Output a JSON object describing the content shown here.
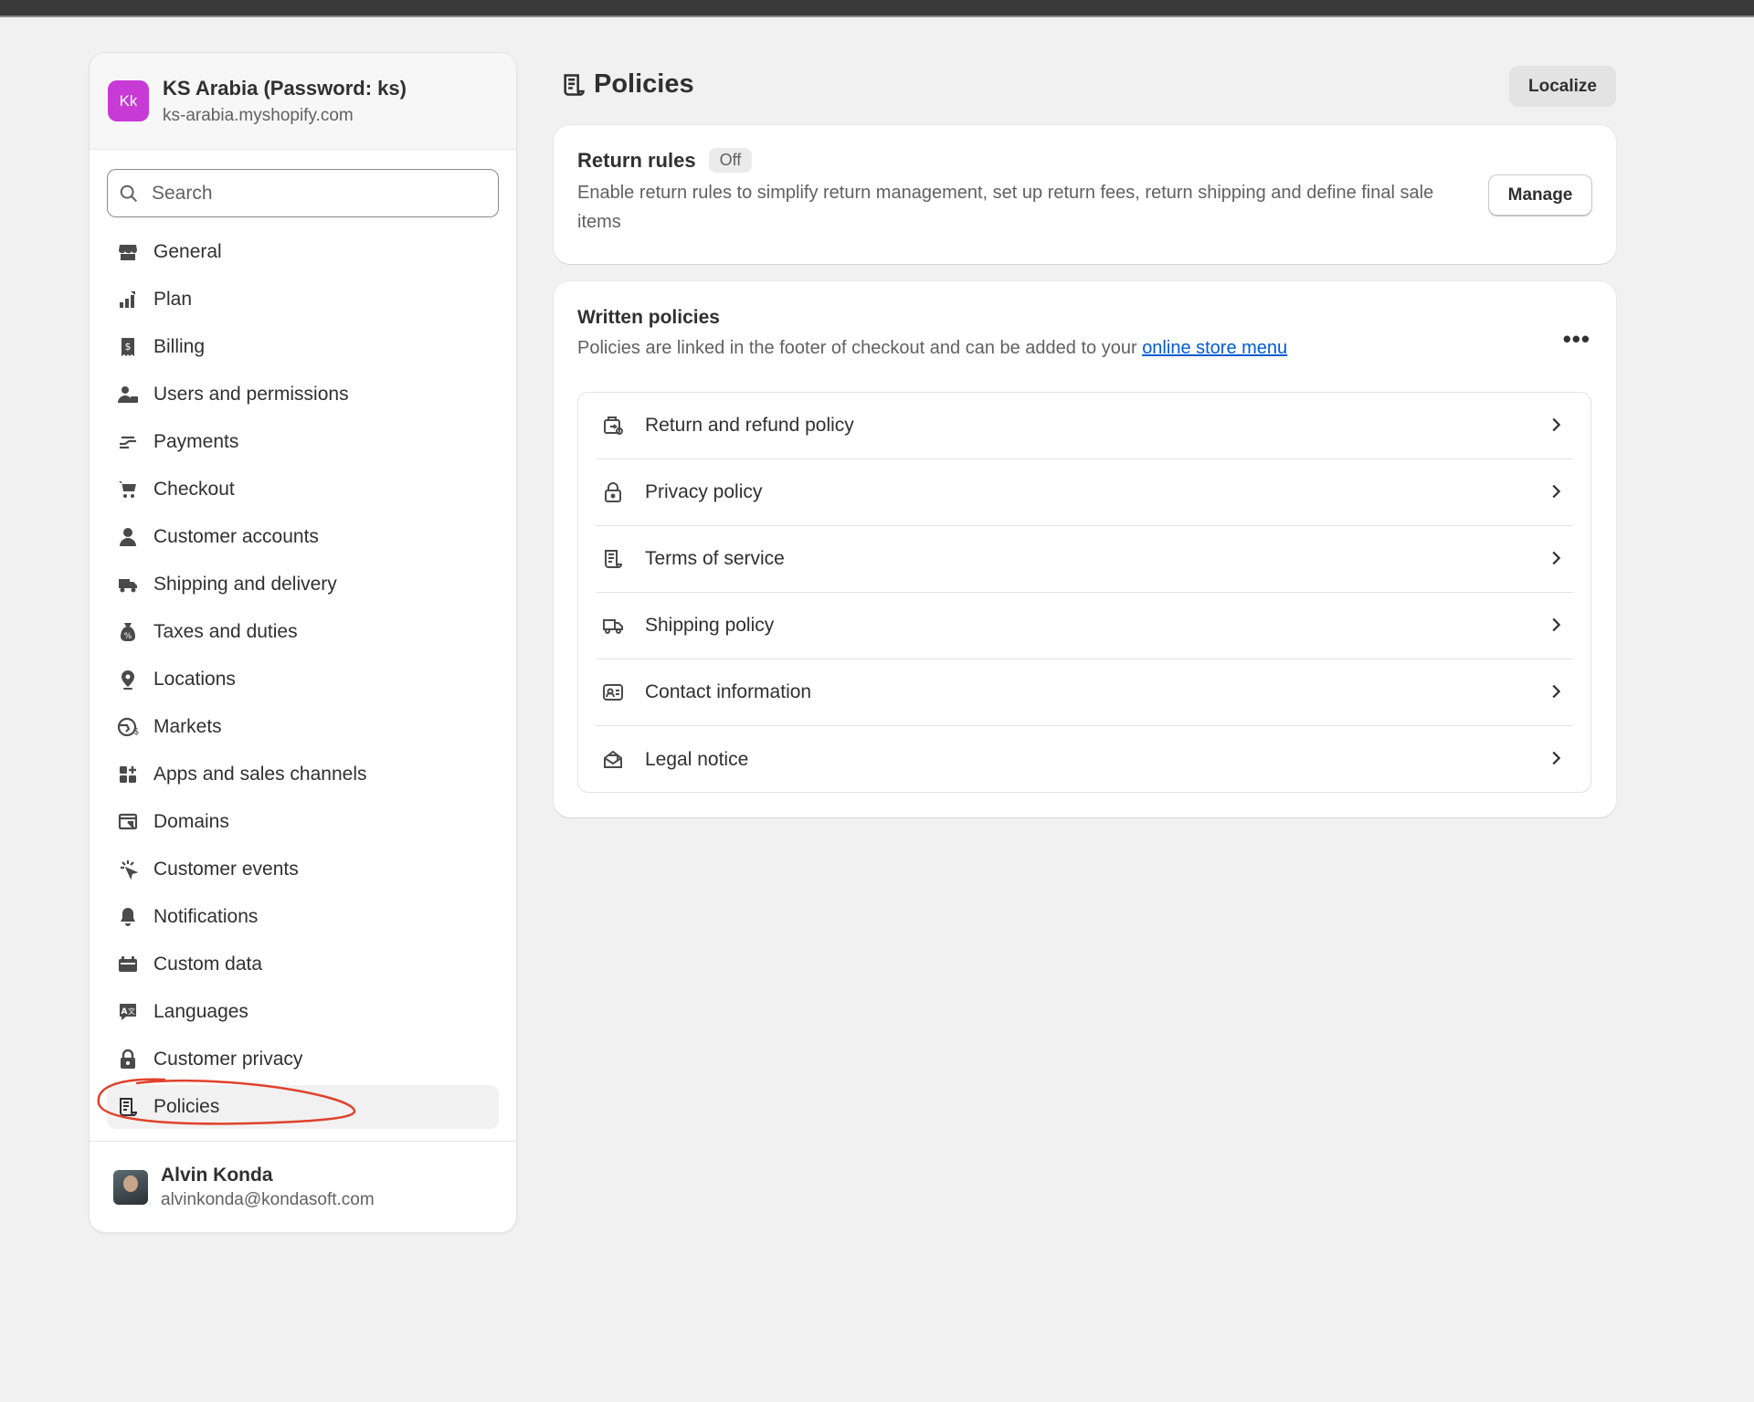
{
  "store": {
    "initials": "Kk",
    "name": "KS Arabia (Password: ks)",
    "domain": "ks-arabia.myshopify.com",
    "avatar_color": "#c73ad6"
  },
  "search": {
    "placeholder": "Search",
    "icon": "search-icon"
  },
  "nav": [
    {
      "label": "General",
      "icon": "store-icon"
    },
    {
      "label": "Plan",
      "icon": "plan-icon"
    },
    {
      "label": "Billing",
      "icon": "billing-icon"
    },
    {
      "label": "Users and permissions",
      "icon": "users-icon"
    },
    {
      "label": "Payments",
      "icon": "payments-icon"
    },
    {
      "label": "Checkout",
      "icon": "cart-icon"
    },
    {
      "label": "Customer accounts",
      "icon": "person-icon"
    },
    {
      "label": "Shipping and delivery",
      "icon": "truck-icon"
    },
    {
      "label": "Taxes and duties",
      "icon": "tax-bag-icon"
    },
    {
      "label": "Locations",
      "icon": "location-pin-icon"
    },
    {
      "label": "Markets",
      "icon": "globe-icon"
    },
    {
      "label": "Apps and sales channels",
      "icon": "apps-icon"
    },
    {
      "label": "Domains",
      "icon": "domains-icon"
    },
    {
      "label": "Customer events",
      "icon": "cursor-click-icon"
    },
    {
      "label": "Notifications",
      "icon": "bell-icon"
    },
    {
      "label": "Custom data",
      "icon": "custom-data-icon"
    },
    {
      "label": "Languages",
      "icon": "translate-icon"
    },
    {
      "label": "Customer privacy",
      "icon": "lock-icon"
    },
    {
      "label": "Policies",
      "icon": "policy-scroll-icon",
      "active": true
    }
  ],
  "user": {
    "name": "Alvin Konda",
    "email": "alvinkonda@kondasoft.com"
  },
  "page": {
    "title": "Policies",
    "localize_label": "Localize"
  },
  "return_rules": {
    "title": "Return rules",
    "status": "Off",
    "description": "Enable return rules to simplify return management, set up return fees, return shipping and define final sale items",
    "manage_label": "Manage"
  },
  "written_policies": {
    "title": "Written policies",
    "description_prefix": "Policies are linked in the footer of checkout and can be added to your ",
    "link_text": "online store menu",
    "more_label": "•••",
    "items": [
      {
        "label": "Return and refund policy",
        "icon": "return-box-icon"
      },
      {
        "label": "Privacy policy",
        "icon": "lock-icon"
      },
      {
        "label": "Terms of service",
        "icon": "policy-scroll-icon"
      },
      {
        "label": "Shipping policy",
        "icon": "truck-icon"
      },
      {
        "label": "Contact information",
        "icon": "contact-card-icon"
      },
      {
        "label": "Legal notice",
        "icon": "envelope-open-icon"
      }
    ]
  },
  "colors": {
    "background": "#f1f1f1",
    "card": "#ffffff",
    "link": "#005bd3",
    "annotation": "#e0412b"
  }
}
